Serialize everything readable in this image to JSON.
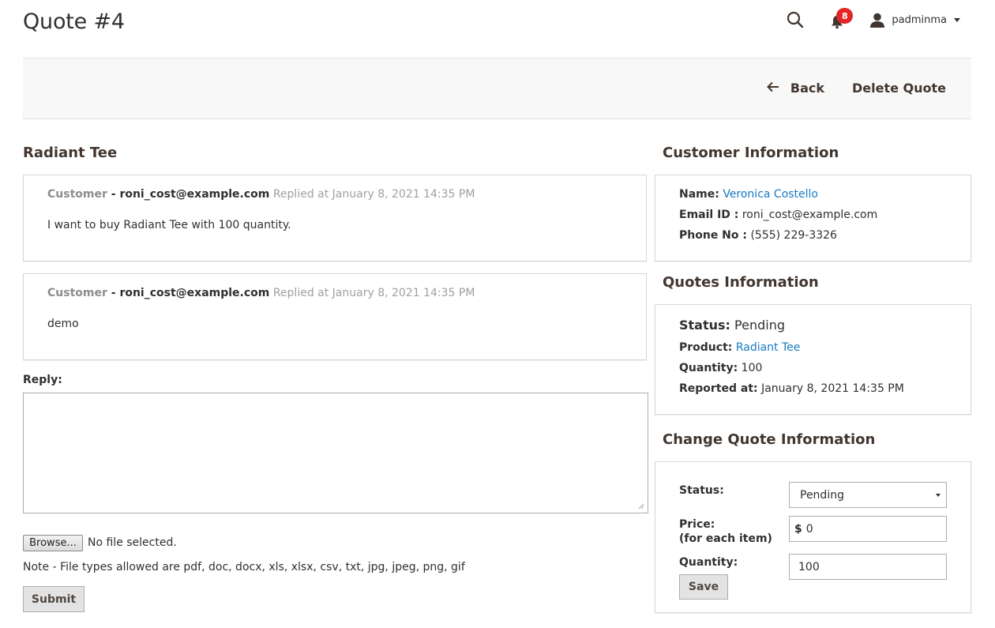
{
  "header": {
    "title": "Quote #4",
    "notification_count": "8",
    "username": "padminma",
    "icons": {
      "search": "search-icon",
      "notifications": "bell-icon",
      "user": "user-icon",
      "dropdown": "chevron-down-icon"
    }
  },
  "action_bar": {
    "back_label": "Back",
    "delete_label": "Delete Quote"
  },
  "conversation": {
    "title": "Radiant Tee",
    "messages": [
      {
        "role": "Customer",
        "separator": " - ",
        "email": "roni_cost@example.com",
        "replied": " Replied at January 8, 2021 14:35 PM",
        "text": "I want to buy Radiant Tee with 100 quantity."
      },
      {
        "role": "Customer",
        "separator": " - ",
        "email": "roni_cost@example.com",
        "replied": " Replied at January 8, 2021 14:35 PM",
        "text": "demo"
      }
    ],
    "reply_label": "Reply:",
    "reply_value": "",
    "browse_label": "Browse...",
    "file_status": "No file selected.",
    "note": "Note - File types allowed are pdf, doc, docx, xls, xlsx, csv, txt, jpg, jpeg, png, gif",
    "submit_label": "Submit"
  },
  "customer_info": {
    "title": "Customer Information",
    "name_label": "Name:",
    "name_value": "Veronica Costello",
    "email_label": "Email ID :",
    "email_value": "roni_cost@example.com",
    "phone_label": "Phone No :",
    "phone_value": "(555) 229-3326"
  },
  "quote_info": {
    "title": "Quotes Information",
    "status_label": "Status:",
    "status_value": "Pending",
    "product_label": "Product:",
    "product_value": "Radiant Tee",
    "quantity_label": "Quantity:",
    "quantity_value": "100",
    "reported_label": "Reported at:",
    "reported_value": "January 8, 2021 14:35 PM"
  },
  "change_quote": {
    "title": "Change Quote Information",
    "status_label": "Status:",
    "status_selected": "Pending",
    "price_label": "Price:",
    "price_sublabel": "(for each item)",
    "price_currency": "$",
    "price_value": "0",
    "quantity_label": "Quantity:",
    "quantity_value": "100",
    "save_label": "Save"
  },
  "colors": {
    "link": "#1979c3",
    "badge": "#e22626",
    "heading": "#41362f",
    "text": "#303030"
  }
}
